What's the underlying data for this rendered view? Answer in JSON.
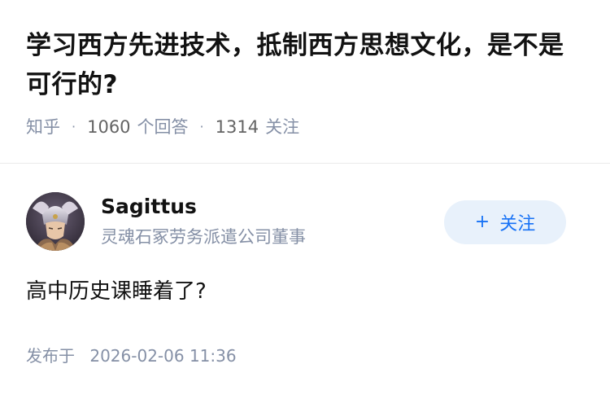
{
  "question": {
    "title": "学习西方先进技术，抵制西方思想文化，是不是可行的?",
    "source": "知乎",
    "answer_count": "1060",
    "answer_label": "个回答",
    "follower_count": "1314",
    "follower_label": "关注",
    "separator": "·"
  },
  "answer": {
    "author": {
      "name": "Sagittus",
      "headline": "灵魂石冢劳务派遣公司董事",
      "avatar_icon": "armored-character-avatar"
    },
    "follow_button": {
      "plus": "+",
      "label": "关注"
    },
    "content": "高中历史课睡着了?",
    "published_label": "发布于",
    "published_time": "2026-02-06 11:36"
  },
  "colors": {
    "title": "#121212",
    "meta": "#8590a6",
    "accent": "#1772f6",
    "follow_bg": "#e8f1fb",
    "divider": "#ebebeb"
  }
}
